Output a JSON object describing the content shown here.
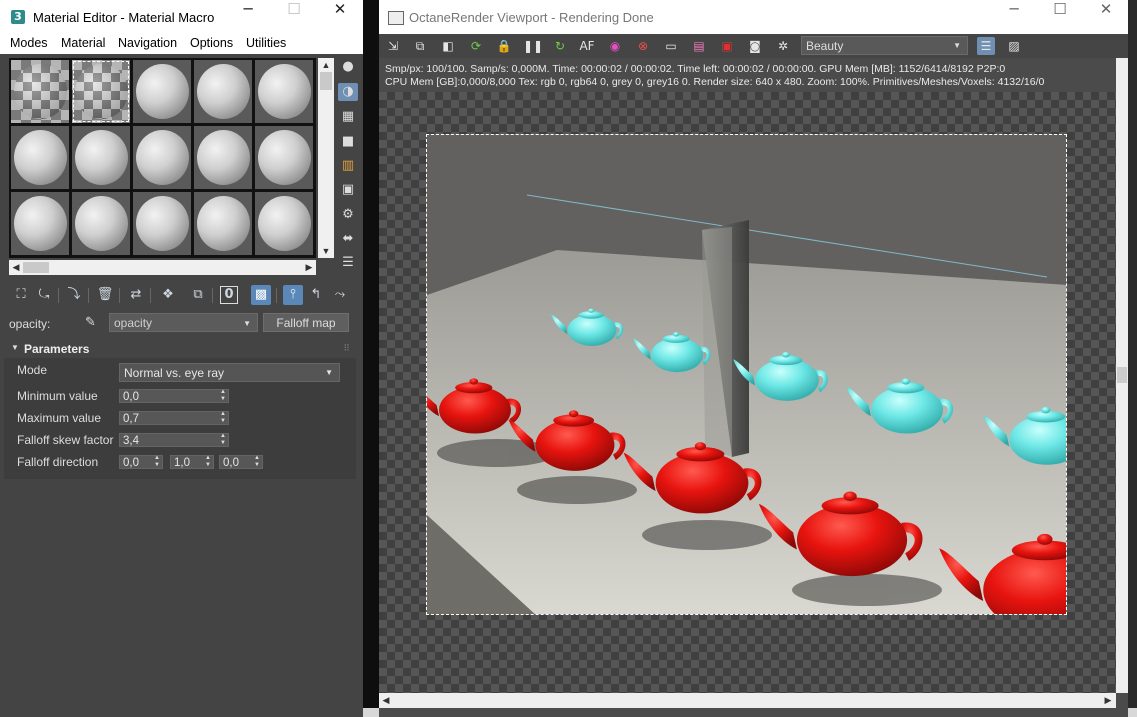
{
  "material_editor": {
    "title": "Material Editor - Material Macro",
    "app_icon": "3",
    "window_buttons": {
      "minimize": "─",
      "maximize": "☐",
      "close": "✕"
    },
    "menu": [
      "Modes",
      "Material",
      "Navigation",
      "Options",
      "Utilities"
    ],
    "slot_rows": 3,
    "slot_cols": 5,
    "opacity_label": "opacity:",
    "opacity_map": "opacity",
    "falloff_button": "Falloff map",
    "parameters": {
      "title": "Parameters",
      "mode_label": "Mode",
      "mode_value": "Normal vs. eye ray",
      "min_label": "Minimum value",
      "min_value": "0,0",
      "max_label": "Maximum value",
      "max_value": "0,7",
      "skew_label": "Falloff skew factor",
      "skew_value": "3,4",
      "dir_label": "Falloff direction",
      "dir_x": "0,0",
      "dir_y": "1,0",
      "dir_z": "0,0"
    }
  },
  "viewport": {
    "title": "OctaneRender Viewport - Rendering Done",
    "window_buttons": {
      "minimize": "─",
      "maximize": "☐",
      "close": "✕"
    },
    "pass": "Beauty",
    "stats_line1": "Smp/px: 100/100.   Samp/s: 0,000M.   Time: 00:00:02 / 00:00:02.   Time left: 00:00:02 / 00:00:00.   GPU Mem [MB]: 1152/6414/8192 P2P:0",
    "stats_line2": "CPU Mem [GB]:0,000/8,000   Tex: rgb 0, rgb64 0, grey 0, grey16 0.   Render size: 640 x 480.   Zoom: 100%.   Primitives/Meshes/Voxels: 4132/16/0",
    "teapot_colors": {
      "red": "#e8140f",
      "cyan": "#6ee8e6"
    }
  }
}
